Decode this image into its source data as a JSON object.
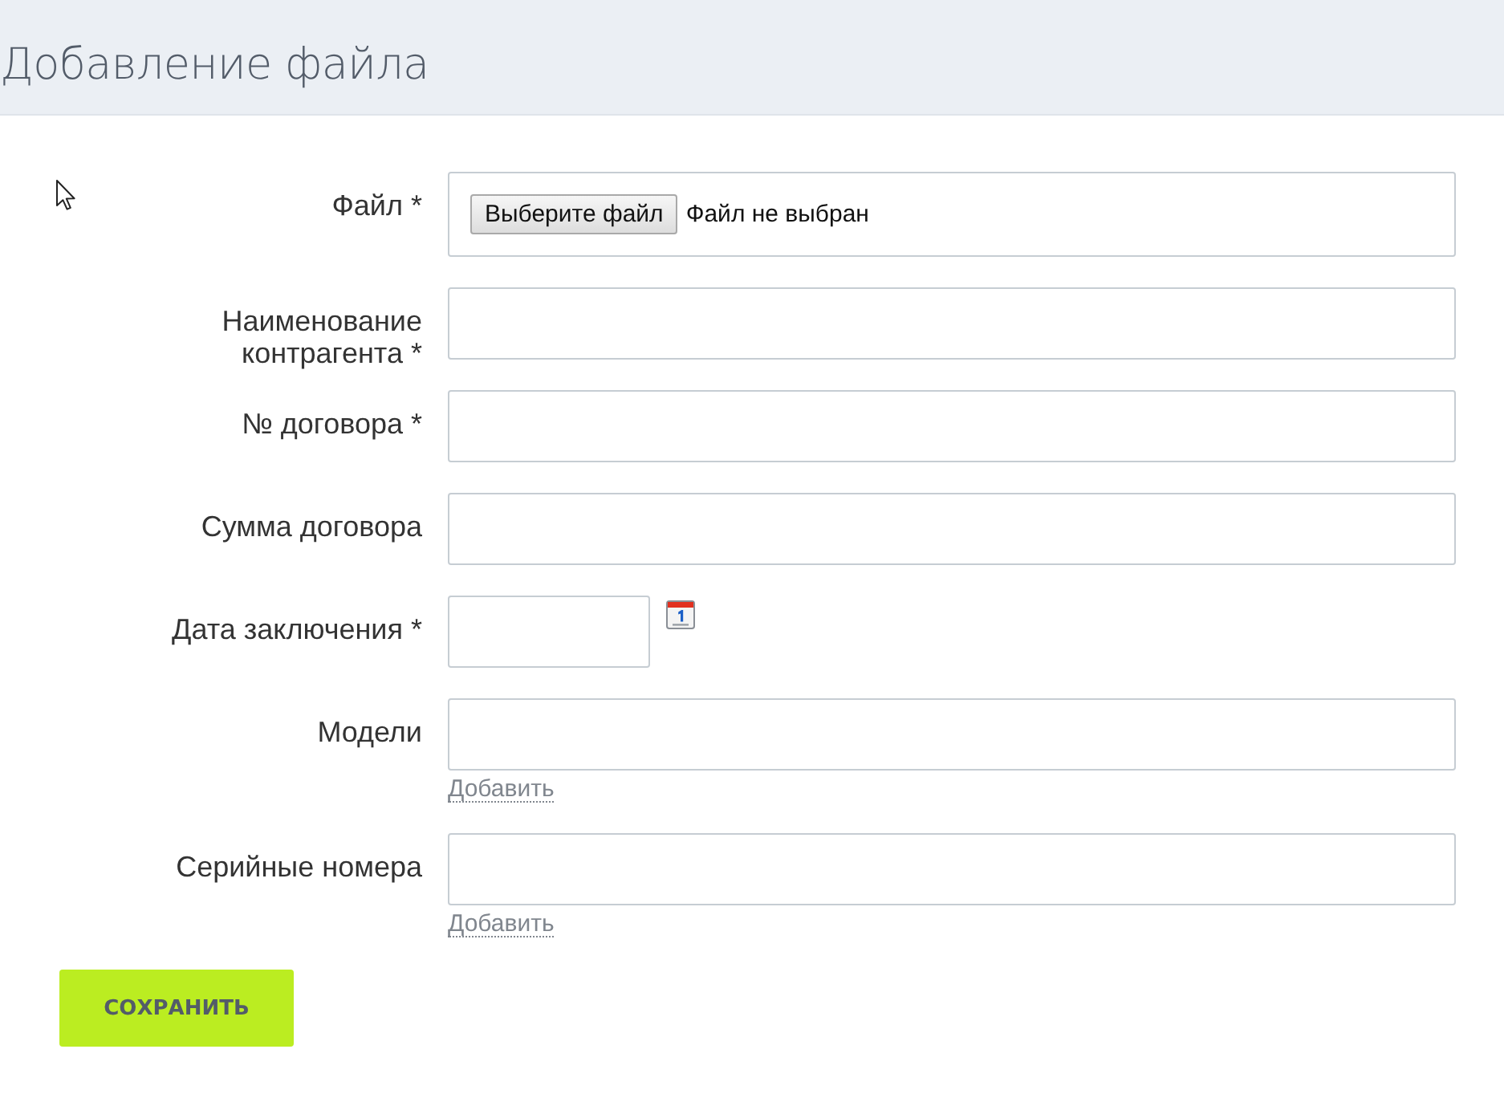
{
  "header": {
    "title": "Добавление файла"
  },
  "fields": [
    {
      "kind": "file",
      "label": "Файл *",
      "button": "Выберите файл",
      "status": "Файл не выбран"
    },
    {
      "kind": "text",
      "label": "Наименование контрагента *"
    },
    {
      "kind": "text",
      "label": "№ договора *"
    },
    {
      "kind": "text",
      "label": "Сумма договора"
    },
    {
      "kind": "date",
      "label": "Дата заключения *"
    },
    {
      "kind": "text",
      "label": "Модели",
      "add_link": "Добавить"
    },
    {
      "kind": "text",
      "label": "Серийные номера",
      "add_link": "Добавить"
    }
  ],
  "save_button": "СОХРАНИТЬ"
}
